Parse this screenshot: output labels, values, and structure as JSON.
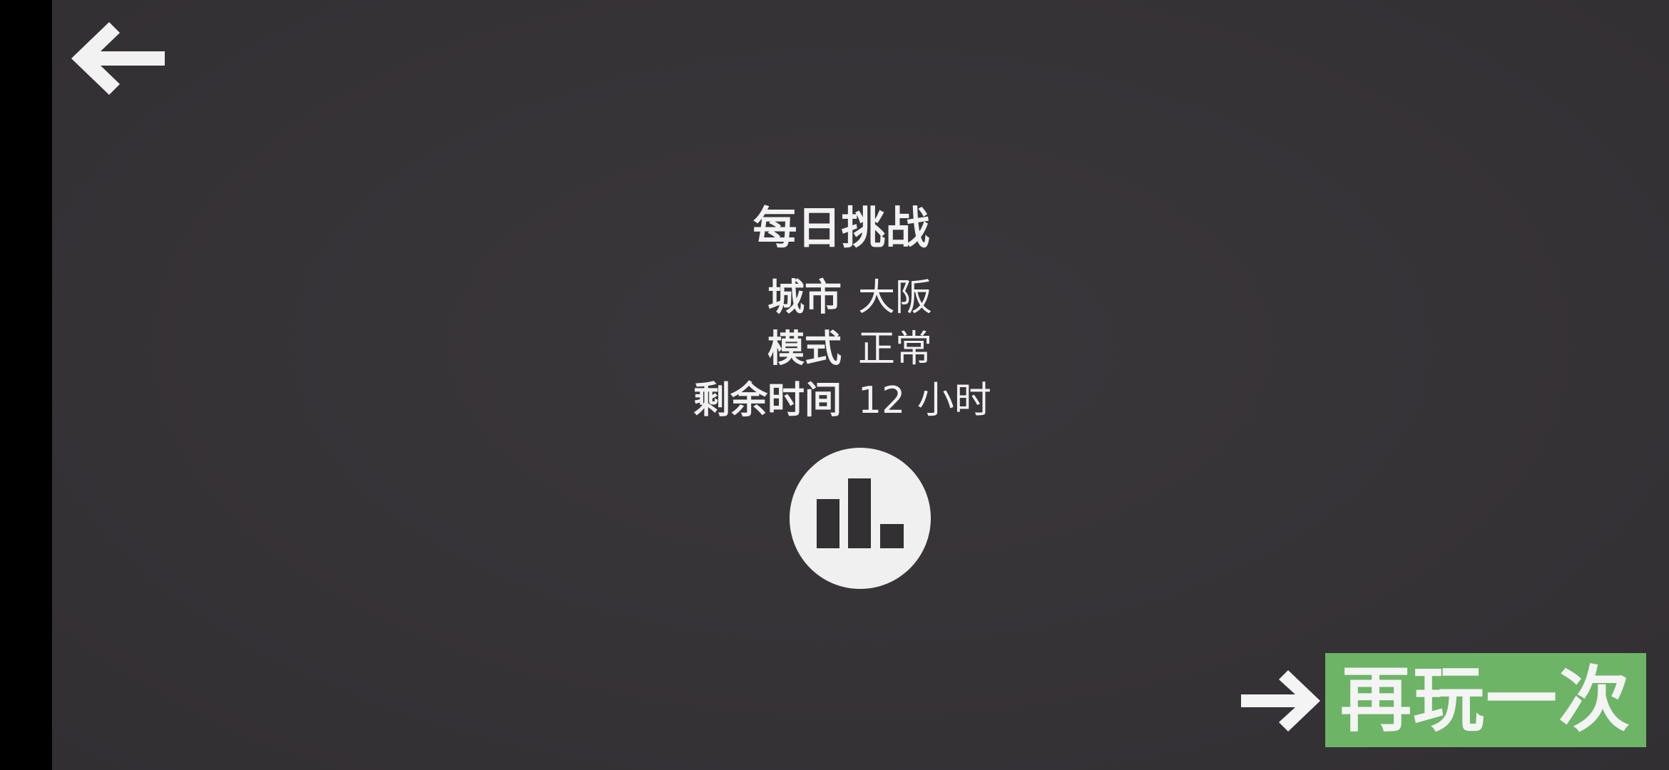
{
  "screen": {
    "title": "每日挑战",
    "info": {
      "city": {
        "label": "城市",
        "value": "大阪"
      },
      "mode": {
        "label": "模式",
        "value": "正常"
      },
      "time_left": {
        "label": "剩余时间",
        "value": "12 小时"
      }
    },
    "back_button": {
      "icon": "left-arrow-icon"
    },
    "stats_button": {
      "icon": "bar-chart-icon"
    },
    "play_again": {
      "label": "再玩一次",
      "icon": "right-arrow-icon",
      "color": "#6db467"
    }
  },
  "colors": {
    "background": "#363337",
    "text": "#f2f2f2",
    "accent_green": "#6db467"
  }
}
